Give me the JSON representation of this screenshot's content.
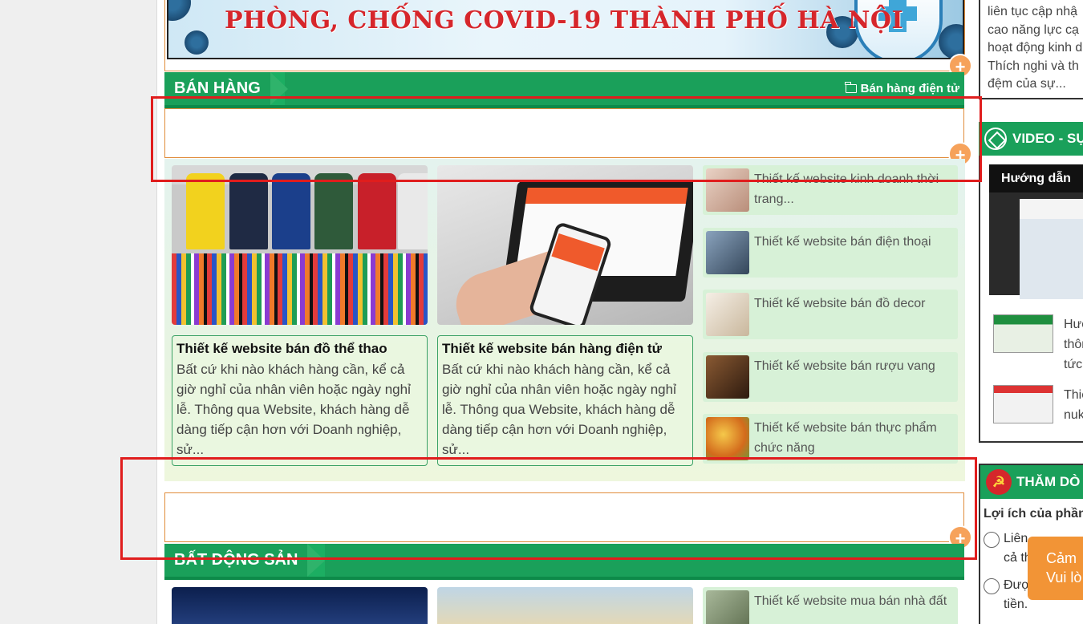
{
  "banner": {
    "title": "PHÒNG, CHỐNG COVID-19 THÀNH PHỐ HÀ NỘI"
  },
  "section_ban_hang": {
    "title": "BÁN HÀNG",
    "link": "Bán hàng điện tử",
    "link_icon": "folder-icon",
    "featured": [
      {
        "title": "Thiết kế website bán đồ thể thao",
        "desc": "Bất cứ khi nào khách hàng cần, kể cả giờ nghỉ của nhân viên hoặc ngày nghỉ lễ. Thông qua Website, khách hàng dễ dàng tiếp cận hơn với Doanh nghiệp, sử..."
      },
      {
        "title": "Thiết kế website bán hàng điện tử",
        "desc": "Bất cứ khi nào khách hàng cần, kể cả giờ nghỉ của nhân viên hoặc ngày nghỉ lễ. Thông qua Website, khách hàng dễ dàng tiếp cận hơn với Doanh nghiệp, sử..."
      }
    ],
    "list": [
      {
        "title": "Thiết kế website kinh doanh thời trang...",
        "thumb_color": "#d8b9a8"
      },
      {
        "title": "Thiết kế website bán điện thoại",
        "thumb_color": "#5a6f86"
      },
      {
        "title": "Thiết kế website bán đồ decor",
        "thumb_color": "#e6dccd"
      },
      {
        "title": "Thiết kế website bán rượu vang",
        "thumb_color": "#5b3a22"
      },
      {
        "title": "Thiết kế website bán thực phẩm chức năng",
        "thumb_color": "#e7a21c"
      }
    ]
  },
  "section_bat_dong_san": {
    "title": "BẤT ĐỘNG SẢN",
    "list": [
      {
        "title": "Thiết kế website mua bán nhà đất"
      }
    ]
  },
  "sidebar": {
    "intro_lines": [
      "liên tục cập nhậ",
      "cao năng lực cạ",
      "hoạt động kinh d",
      "Thích nghi và th",
      "đệm của sự..."
    ],
    "video_header": "VIDEO - SỰ",
    "video_title": "Hướng dẫn",
    "video_items": [
      {
        "lines": [
          "Hướ",
          "thôn",
          "tức"
        ]
      },
      {
        "lines": [
          "Thiế",
          "nuk"
        ]
      }
    ],
    "poll_header": "THĂM DÒ",
    "poll_question": "Lợi ích của phần",
    "poll_options": [
      {
        "lines": [
          "Liên",
          "cả th"
        ]
      },
      {
        "lines": [
          "Được",
          "tiền."
        ]
      }
    ]
  },
  "chat_popup": {
    "line1": "Cảm",
    "line2": "Vui lò"
  },
  "colors": {
    "accent_green": "#1aa05a",
    "orange": "#f29436",
    "highlight_red": "#e01d1d"
  }
}
